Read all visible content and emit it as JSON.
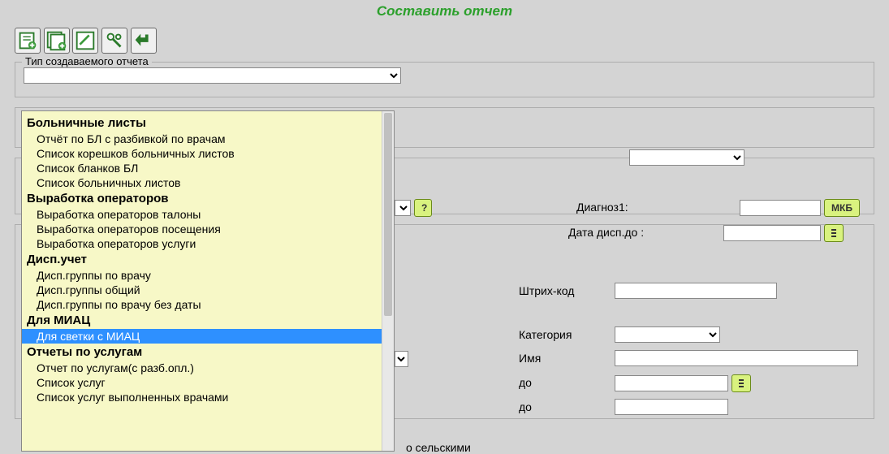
{
  "title": "Составить отчет",
  "toolbar": {
    "icons": [
      "doc-plus",
      "doc-plus-2",
      "pencil",
      "wrench",
      "back-arrow"
    ]
  },
  "fieldset_report_type": {
    "legend": "Тип создаваемого отчета",
    "selected": ""
  },
  "dropdown": [
    {
      "type": "group",
      "label": "Больничные листы"
    },
    {
      "type": "item",
      "label": "Отчёт по БЛ с разбивкой по врачам"
    },
    {
      "type": "item",
      "label": "Список корешков больничных листов"
    },
    {
      "type": "item",
      "label": "Список бланков БЛ"
    },
    {
      "type": "item",
      "label": "Список больничных листов"
    },
    {
      "type": "group",
      "label": "Выработка операторов"
    },
    {
      "type": "item",
      "label": "Выработка операторов талоны"
    },
    {
      "type": "item",
      "label": "Выработка операторов посещения"
    },
    {
      "type": "item",
      "label": "Выработка операторов услуги"
    },
    {
      "type": "group",
      "label": "Дисп.учет"
    },
    {
      "type": "item",
      "label": "Дисп.группы по врачу"
    },
    {
      "type": "item",
      "label": "Дисп.группы общий"
    },
    {
      "type": "item",
      "label": "Дисп.группы по врачу без даты"
    },
    {
      "type": "group",
      "label": "Для МИАЦ"
    },
    {
      "type": "item",
      "label": "Для светки с МИАЦ",
      "highlight": true
    },
    {
      "type": "group",
      "label": "Отчеты по услугам"
    },
    {
      "type": "item",
      "label": "Отчет по услугам(с разб.опл.)"
    },
    {
      "type": "item",
      "label": "Список услуг"
    },
    {
      "type": "item",
      "label": "Список услуг выполненных врачами"
    }
  ],
  "fields": {
    "diagnoz1_label": "Диагноз1:",
    "diagnoz1_btn": "МКБ",
    "date_disp_do_label": "Дата дисп.до :",
    "shtrih_kod_label": "Штрих-код",
    "kategoria_label": "Категория",
    "imya_label": "Имя",
    "do1_label": "до",
    "do2_label": "до",
    "question": "?",
    "rural_text": "о сельскими"
  }
}
